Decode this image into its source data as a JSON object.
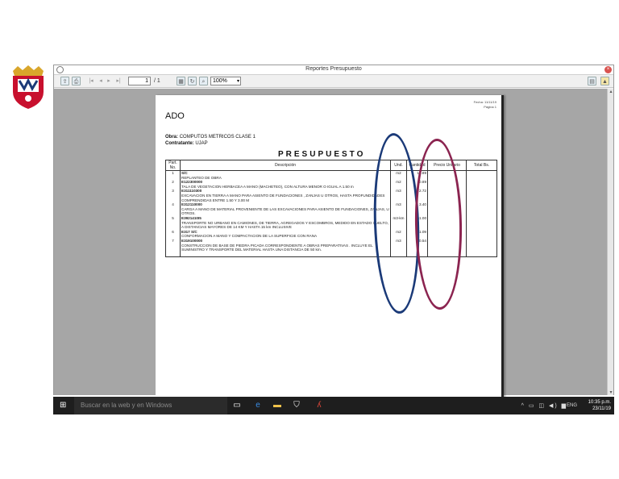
{
  "window": {
    "title": "Reportes Presupuesto"
  },
  "toolbar": {
    "current_page": "1",
    "total_pages": "/ 1",
    "zoom": "100%"
  },
  "report": {
    "meta_line1": "Fecha: 11/11/19",
    "meta_line2": "Página 1",
    "heading": "ADO",
    "obra_label": "Obra:",
    "obra_value": "COMPUTOS METRICOS CLASE 1",
    "contratante_label": "Contratante:",
    "contratante_value": "UJAP",
    "title": "PRESUPUESTO",
    "columns": [
      "Part. No.",
      "Descripción",
      "Und.",
      "Cantidad",
      "Precio Unitario",
      "Total Bs."
    ],
    "rows": [
      {
        "num": "1",
        "code": "S/C",
        "desc": "REPLANTEO DE OBRA",
        "und": "m2",
        "cant": "10.89"
      },
      {
        "num": "2",
        "code": "E122300000",
        "desc": "TALA DE VEGETACION HERBACEA A MANO  (MACHETEO), CON ALTURA MENOR O IGUAL A 1.50 m",
        "und": "m2",
        "cant": "10.89"
      },
      {
        "num": "3",
        "code": "E311110300",
        "desc": "EXCAVACION EN TIERRA A MANO PARA ASIENTO DE FUNDACIONES , ZANJAS U OTROS, HASTA PROFUNDIDADES COMPRENDIDAS ENTRE 1.50 Y 3.00 M",
        "und": "m3",
        "cant": "2.72"
      },
      {
        "num": "4",
        "code": "E312110000",
        "desc": "CARGA A MANO DE MATERIAL PROVENIENTE DE LAS EXCAVACIONES PARA ASIENTO DE FUNDACIONES, ZANJAS, U OTROS.",
        "und": "m3",
        "cant": "3.40"
      },
      {
        "num": "5",
        "code": "E3921410I5",
        "desc": "TRANSPORTE NO URBANO EN CAMIONES, DE TIERRA, AGREGADOS Y ESCOMBROS, MEDIDO EN ESTADO SUELTO, A DISTANCIAS MAYORES DE 14 KM Y HASTA 15 km INCLUSIVE",
        "und": "m3-km",
        "cant": "51.00"
      },
      {
        "num": "6",
        "code": "E317 S/C",
        "desc": "CONFORMACION A MANO Y COMPACTACION DE LA SUPERFICIE CON RANA",
        "und": "m2",
        "cant": "1.09"
      },
      {
        "num": "7",
        "code": "E319100000",
        "desc": "CONSTRUCCION DE BASE DE PIEDRA PICADA CORRESPONDIENTE A OBRAS PREPARATIVAS . INCLUYE EL SUMINISTRO Y TRANSPORTE DEL MATERIAL HASTA UNA DISTANCIA DE  50 km.",
        "und": "m3",
        "cant": "0.54"
      }
    ]
  },
  "taskbar": {
    "search_placeholder": "Buscar en la web y en Windows",
    "language": "ENG",
    "time": "10:35 p.m.",
    "date": "23/11/19"
  },
  "colors": {
    "annotation_blue": "#1b3a78",
    "annotation_red": "#8b2450",
    "taskbar": "#1e1e1e",
    "viewport": "#a6a6a6"
  }
}
